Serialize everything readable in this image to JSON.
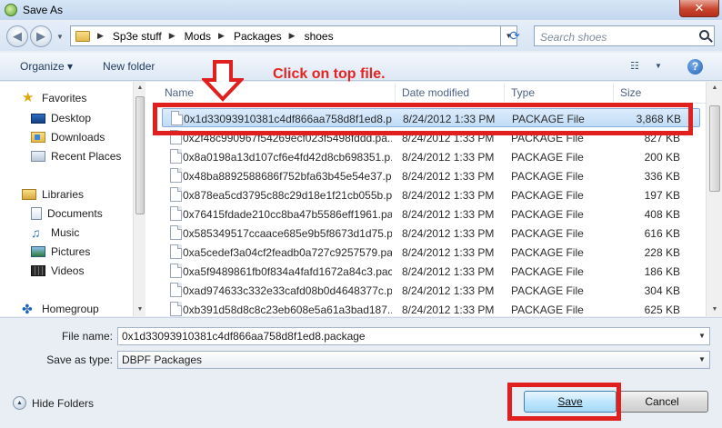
{
  "window": {
    "title": "Save As",
    "close_glyph": "✕"
  },
  "address": {
    "breadcrumbs": [
      "Sp3e stuff",
      "Mods",
      "Packages",
      "shoes"
    ],
    "search_placeholder": "Search shoes"
  },
  "toolbar": {
    "organize": "Organize ▾",
    "new_folder": "New folder",
    "help": "?"
  },
  "nav": {
    "favorites": "Favorites",
    "desktop": "Desktop",
    "downloads": "Downloads",
    "recent_places": "Recent Places",
    "libraries": "Libraries",
    "documents": "Documents",
    "music": "Music",
    "pictures": "Pictures",
    "videos": "Videos",
    "homegroup": "Homegroup"
  },
  "columns": {
    "name": "Name",
    "date": "Date modified",
    "type": "Type",
    "size": "Size"
  },
  "files": [
    {
      "name": "0x1d33093910381c4df866aa758d8f1ed8.p...",
      "date": "8/24/2012 1:33 PM",
      "type": "PACKAGE File",
      "size": "3,868 KB"
    },
    {
      "name": "0x2f48c990967f54269ecf023f5498fddd.pa...",
      "date": "8/24/2012 1:33 PM",
      "type": "PACKAGE File",
      "size": "827 KB"
    },
    {
      "name": "0x8a0198a13d107cf6e4fd42d8cb698351.p...",
      "date": "8/24/2012 1:33 PM",
      "type": "PACKAGE File",
      "size": "200 KB"
    },
    {
      "name": "0x48ba8892588686f752bfa63b45e54e37.p...",
      "date": "8/24/2012 1:33 PM",
      "type": "PACKAGE File",
      "size": "336 KB"
    },
    {
      "name": "0x878ea5cd3795c88c29d18e1f21cb055b.p...",
      "date": "8/24/2012 1:33 PM",
      "type": "PACKAGE File",
      "size": "197 KB"
    },
    {
      "name": "0x76415fdade210cc8ba47b5586eff1961.pa...",
      "date": "8/24/2012 1:33 PM",
      "type": "PACKAGE File",
      "size": "408 KB"
    },
    {
      "name": "0x585349517ccaace685e9b5f8673d1d75.p...",
      "date": "8/24/2012 1:33 PM",
      "type": "PACKAGE File",
      "size": "616 KB"
    },
    {
      "name": "0xa5cedef3a04cf2feadb0a727c9257579.pa...",
      "date": "8/24/2012 1:33 PM",
      "type": "PACKAGE File",
      "size": "228 KB"
    },
    {
      "name": "0xa5f9489861fb0f834a4fafd1672a84c3.pac...",
      "date": "8/24/2012 1:33 PM",
      "type": "PACKAGE File",
      "size": "186 KB"
    },
    {
      "name": "0xad974633c332e33cafd08b0d4648377c.p...",
      "date": "8/24/2012 1:33 PM",
      "type": "PACKAGE File",
      "size": "304 KB"
    },
    {
      "name": "0xb391d58d8c8c23eb608e5a61a3bad187....",
      "date": "8/24/2012 1:33 PM",
      "type": "PACKAGE File",
      "size": "625 KB"
    }
  ],
  "fields": {
    "file_name_label": "File name:",
    "file_name_value": "0x1d33093910381c4df866aa758d8f1ed8.package",
    "save_type_label": "Save as type:",
    "save_type_value": "DBPF Packages"
  },
  "buttons": {
    "hide_folders": "Hide Folders",
    "save": "Save",
    "cancel": "Cancel"
  },
  "annotation": {
    "text": "Click on top file."
  },
  "colors": {
    "annotation_red": "#e01f1f",
    "selection": "#c1dcf6",
    "link_blue": "#1e395b"
  }
}
